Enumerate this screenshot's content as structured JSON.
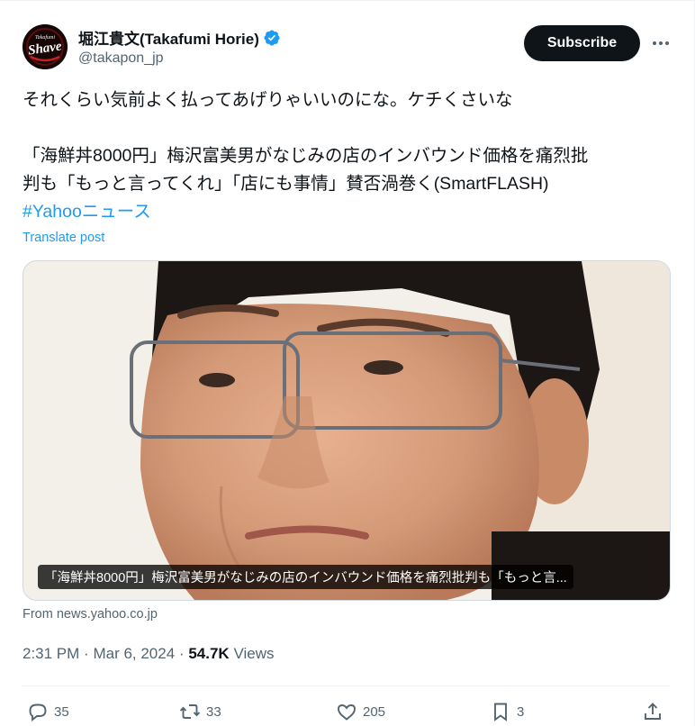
{
  "author": {
    "display_name": "堀江貴文(Takafumi Horie)",
    "handle": "@takapon_jp",
    "avatar_text": "Shave",
    "avatar_subtext": "Takafumi"
  },
  "header": {
    "subscribe_label": "Subscribe"
  },
  "tweet": {
    "line1": "それくらい気前よく払ってあげりゃいいのにな。ケチくさいな",
    "line2": "「海鮮丼8000円」梅沢富美男がなじみの店のインバウンド価格を痛烈批",
    "line3": "判も「もっと言ってくれ」「店にも事情」賛否渦巻く(SmartFLASH)",
    "hashtag": "#Yahooニュース",
    "translate_label": "Translate post"
  },
  "card": {
    "caption": "「海鮮丼8000円」梅沢富美男がなじみの店のインバウンド価格を痛烈批判も「もっと言...",
    "source": "From news.yahoo.co.jp"
  },
  "meta": {
    "time": "2:31 PM",
    "sep": "·",
    "date": "Mar 6, 2024",
    "views_count": "54.7K",
    "views_label": "Views"
  },
  "actions": {
    "replies": "35",
    "reposts": "33",
    "likes": "205",
    "bookmarks": "3"
  },
  "colors": {
    "accent": "#1d9bf0",
    "text": "#0f1419",
    "muted": "#536471",
    "border": "#cfd9de"
  },
  "icons": [
    "verified-icon",
    "more-icon",
    "reply-icon",
    "repost-icon",
    "like-icon",
    "bookmark-icon",
    "share-icon"
  ]
}
